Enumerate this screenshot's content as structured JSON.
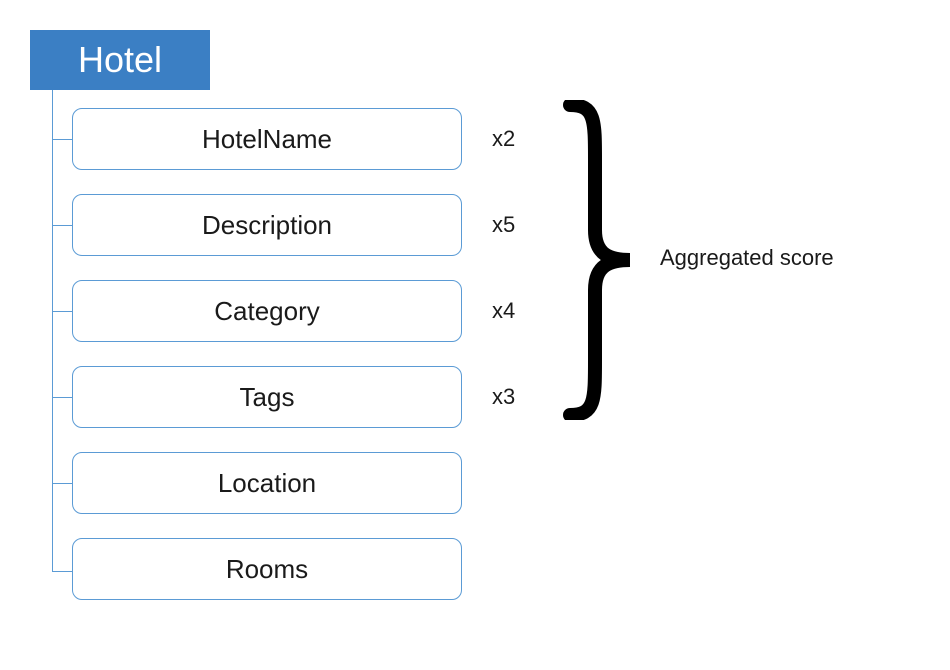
{
  "root": {
    "label": "Hotel"
  },
  "children": [
    {
      "label": "HotelName",
      "weight": "x2"
    },
    {
      "label": "Description",
      "weight": "x5"
    },
    {
      "label": "Category",
      "weight": "x4"
    },
    {
      "label": "Tags",
      "weight": "x3"
    },
    {
      "label": "Location",
      "weight": ""
    },
    {
      "label": "Rooms",
      "weight": ""
    }
  ],
  "aggregated_label": "Aggregated score"
}
